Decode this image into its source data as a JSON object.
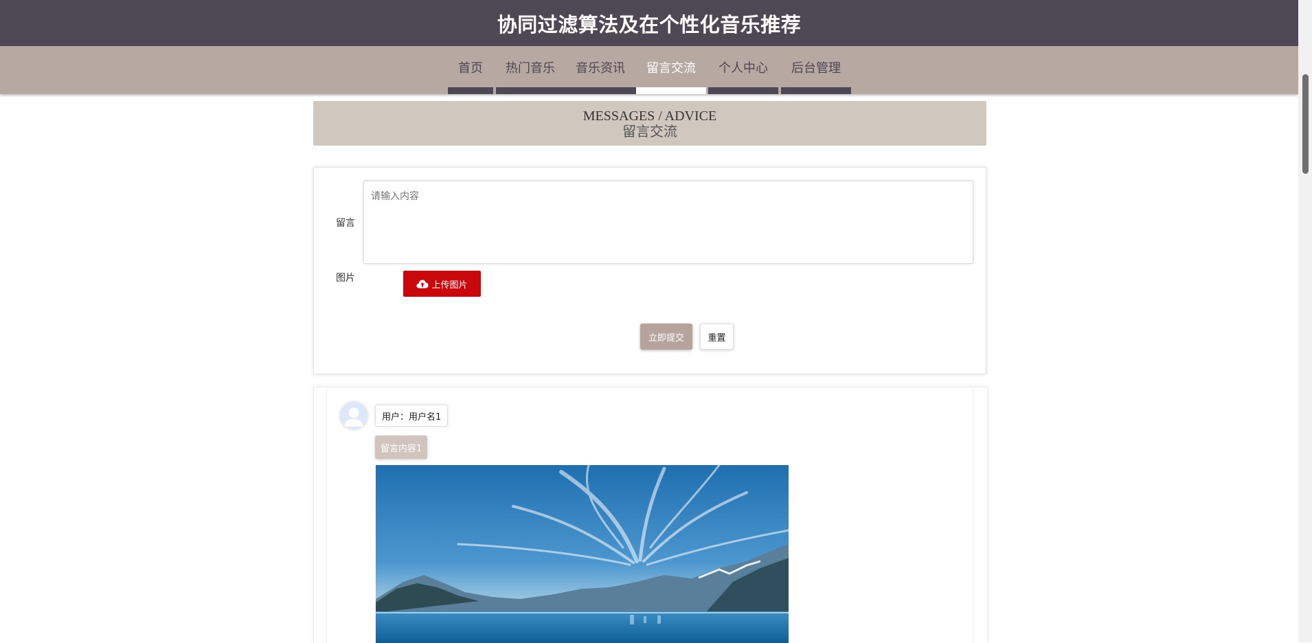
{
  "header": {
    "title": "协同过滤算法及在个性化音乐推荐"
  },
  "nav": {
    "items": [
      {
        "label": "首页",
        "active": false
      },
      {
        "label": "热门音乐",
        "active": false
      },
      {
        "label": "音乐资讯",
        "active": false
      },
      {
        "label": "留言交流",
        "active": true
      },
      {
        "label": "个人中心",
        "active": false
      },
      {
        "label": "后台管理",
        "active": false
      }
    ]
  },
  "banner": {
    "en": "MESSAGES / ADVICE",
    "cn": "留言交流"
  },
  "form": {
    "message_label": "留言",
    "message_placeholder": "请输入内容",
    "image_label": "图片",
    "upload_label": "上传图片",
    "submit_label": "立即提交",
    "reset_label": "重置"
  },
  "comments": [
    {
      "user": "用户：用户名1",
      "content": "留言内容1"
    }
  ],
  "colors": {
    "header_bg": "#4e4754",
    "nav_bg": "#b8a8a2",
    "banner_bg": "#d0c7bf",
    "upload_btn": "#c9080c",
    "submit_btn": "#b5a39c"
  }
}
